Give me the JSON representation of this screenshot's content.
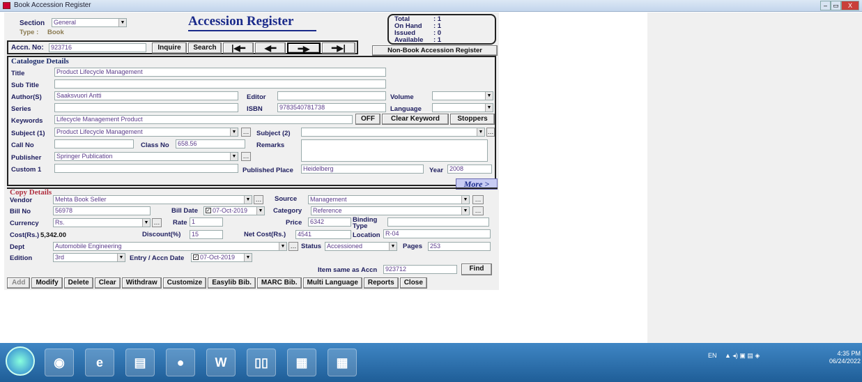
{
  "window": {
    "title": "Book Accession Register",
    "controls": [
      "–",
      "▭",
      "X"
    ]
  },
  "header": {
    "section_label": "Section",
    "section_value": "General",
    "type_label": "Type :",
    "type_value": "Book",
    "title": "Accession Register",
    "stats": {
      "total_label": "Total",
      "total": ": 1",
      "onhand_label": "On Hand",
      "onhand": ": 1",
      "issued_label": "Issued",
      "issued": ": 0",
      "available_label": "Available",
      "available": ": 1"
    },
    "accn_label": "Accn. No:",
    "accn_value": "923716",
    "inquire": "Inquire",
    "search": "Search",
    "nonbook": "Non-Book Accession Register"
  },
  "catalogue": {
    "heading": "Catalogue Details",
    "title_label": "Title",
    "title_value": "Product Lifecycle Management",
    "subtitle_label": "Sub Title",
    "subtitle_value": "",
    "author_label": "Author(S)",
    "author_value": "Saaksvuori Antti",
    "editor_label": "Editor",
    "editor_value": "",
    "volume_label": "Volume",
    "volume_value": "",
    "series_label": "Series",
    "series_value": "",
    "isbn_label": "ISBN",
    "isbn_value": "9783540781738",
    "language_label": "Language",
    "language_value": "",
    "keywords_label": "Keywords",
    "keywords_value": "Lifecycle Management Product",
    "off": "OFF",
    "clear_keyword": "Clear Keyword",
    "stoppers": "Stoppers",
    "subject1_label": "Subject (1)",
    "subject1_value": "Product Lifecycle Management",
    "subject2_label": "Subject (2)",
    "subject2_value": "",
    "callno_label": "Call No",
    "callno_value": "",
    "classno_label": "Class No",
    "classno_value": "658.56",
    "remarks_label": "Remarks",
    "remarks_value": "",
    "publisher_label": "Publisher",
    "publisher_value": "Springer Publication",
    "custom1_label": "Custom 1",
    "custom1_value": "",
    "pubplace_label": "Published Place",
    "pubplace_value": "Heidelberg",
    "year_label": "Year",
    "year_value": "2008"
  },
  "more": "More >",
  "copy": {
    "heading": "Copy Details",
    "vendor_label": "Vendor",
    "vendor_value": "Mehta Book Seller",
    "source_label": "Source",
    "source_value": "Management",
    "billno_label": "Bill No",
    "billno_value": "56978",
    "billdate_label": "Bill Date",
    "billdate_value": "07-Oct-2019",
    "category_label": "Category",
    "category_value": "Reference",
    "currency_label": "Currency",
    "currency_value": "Rs.",
    "rate_label": "Rate",
    "rate_value": "1",
    "price_label": "Price",
    "price_value": "6342",
    "binding_label": "Binding Type",
    "binding_value": "",
    "cost_label": "Cost(Rs.)",
    "cost_value": "5,342.00",
    "discount_label": "Discount(%)",
    "discount_value": "15",
    "netcost_label": "Net Cost(Rs.)",
    "netcost_value": "4541",
    "location_label": "Location",
    "location_value": "R-04",
    "dept_label": "Dept",
    "dept_value": "Automobile Engineering",
    "status_label": "Status",
    "status_value": "Accessioned",
    "pages_label": "Pages",
    "pages_value": "253",
    "edition_label": "Edition",
    "edition_value": "3rd",
    "entry_label": "Entry / Accn Date",
    "entry_value": "07-Oct-2019",
    "itemsame_label": "Item same as Accn",
    "itemsame_value": "923712",
    "find": "Find"
  },
  "toolbar": [
    "Add",
    "Modify",
    "Delete",
    "Clear",
    "Withdraw",
    "Customize",
    "Easylib Bib.",
    "MARC Bib.",
    "Multi Language",
    "Reports",
    "Close"
  ],
  "taskbar": {
    "lang": "EN",
    "time": "4:35 PM",
    "date": "06/24/2022"
  }
}
